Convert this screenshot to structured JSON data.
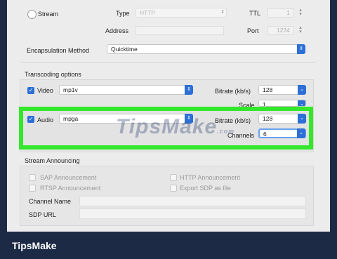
{
  "stream": {
    "radio_label": "Stream",
    "type_label": "Type",
    "type_value": "HTTP",
    "ttl_label": "TTL",
    "ttl_value": "1",
    "address_label": "Address",
    "address_value": "",
    "port_label": "Port",
    "port_value": "1234"
  },
  "encapsulation": {
    "label": "Encapsulation Method",
    "value": "Quicktime"
  },
  "transcoding": {
    "title": "Transcoding options",
    "video": {
      "label": "Video",
      "codec": "mp1v",
      "bitrate_label": "Bitrate (kb/s)",
      "bitrate_value": "128",
      "scale_label": "Scale",
      "scale_value": "1"
    },
    "audio": {
      "label": "Audio",
      "codec": "mpga",
      "bitrate_label": "Bitrate (kb/s)",
      "bitrate_value": "128",
      "channels_label": "Channels",
      "channels_value": "6"
    }
  },
  "announce": {
    "title": "Stream Announcing",
    "sap": "SAP Announcement",
    "rtsp": "RTSP Announcement",
    "http": "HTTP Announcement",
    "export_sdp": "Export SDP as file",
    "channel_name_label": "Channel Name",
    "sdp_url_label": "SDP URL"
  },
  "watermark": {
    "text": "TipsMake",
    "suffix": ".com"
  },
  "footer": {
    "brand": "TipsMake"
  },
  "colors": {
    "accent": "#2d6fd6",
    "highlight": "#33e82a",
    "footer_bg": "#1d2a45"
  }
}
